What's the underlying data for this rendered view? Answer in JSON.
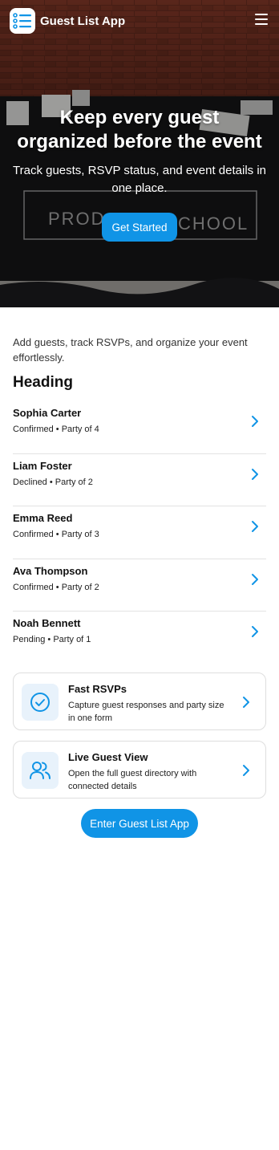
{
  "header": {
    "app_title": "Guest List App",
    "logo_icon": "list-icon",
    "menu_icon": "hamburger-menu-icon"
  },
  "hero": {
    "title_line1": "Keep every guest",
    "title_line2": "organized before the event",
    "subtitle": "Track guests, RSVP status, and event details in one place.",
    "cta_label": "Get Started"
  },
  "main": {
    "intro": "Add guests, track RSVPs, and organize your event effortlessly.",
    "heading": "Heading",
    "guests": [
      {
        "name": "Sophia Carter",
        "meta": "Confirmed • Party of 4"
      },
      {
        "name": "Liam Foster",
        "meta": "Declined • Party of 2"
      },
      {
        "name": "Emma Reed",
        "meta": "Confirmed • Party of 3"
      },
      {
        "name": "Ava Thompson",
        "meta": "Confirmed • Party of 2"
      },
      {
        "name": "Noah Bennett",
        "meta": "Pending • Party of 1"
      }
    ],
    "features": [
      {
        "title": "Fast RSVPs",
        "desc": "Capture guest responses and party size in one form",
        "icon": "check-circle-icon"
      },
      {
        "title": "Live Guest View",
        "desc": "Open the full guest directory with connected details",
        "icon": "users-icon"
      }
    ],
    "enter_label": "Enter Guest List App"
  },
  "colors": {
    "accent": "#1094e6",
    "icon_bg": "#e8f2fb"
  }
}
